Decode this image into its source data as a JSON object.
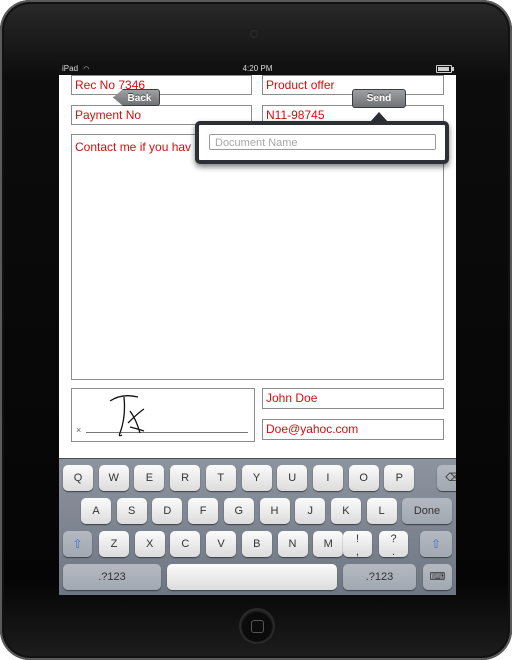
{
  "status_bar": {
    "carrier": "iPad",
    "time": "4:20 PM",
    "battery_level": 0.85
  },
  "nav": {
    "back_label": "Back",
    "send_label": "Send"
  },
  "popover": {
    "document_name_placeholder": "Document Name"
  },
  "form": {
    "rec_no": "Rec No 7346",
    "product": "Product offer",
    "payment": "Payment No",
    "code": "N11-98745",
    "message": "Contact me if you hav",
    "name": "John Doe",
    "email": "Doe@yahoc.com",
    "signature_x": "×"
  },
  "keyboard": {
    "row1": [
      "Q",
      "W",
      "E",
      "R",
      "T",
      "Y",
      "U",
      "I",
      "O",
      "P"
    ],
    "row2": [
      "A",
      "S",
      "D",
      "F",
      "G",
      "H",
      "J",
      "K",
      "L"
    ],
    "row3": [
      "Z",
      "X",
      "C",
      "V",
      "B",
      "N",
      "M"
    ],
    "row3_punct1": [
      "!",
      ","
    ],
    "row3_punct2": [
      "?",
      "."
    ],
    "done_label": "Done",
    "numbers_label": ".?123",
    "backspace_icon": "⌫",
    "shift_icon": "⇧",
    "hide_keyboard_icon": "⌨"
  },
  "icons": {
    "wifi": "wifi-icon",
    "battery": "battery-icon"
  },
  "colors": {
    "field_text": "#d01010",
    "popover_border": "#2c2f36"
  }
}
